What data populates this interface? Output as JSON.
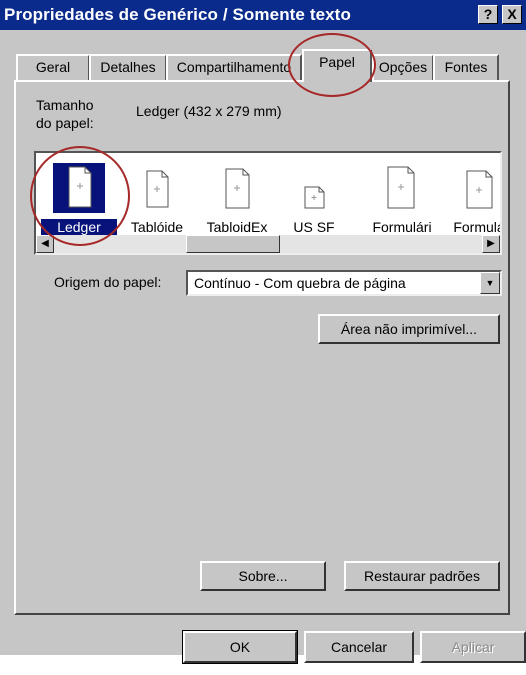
{
  "title": "Propriedades de Genérico / Somente texto",
  "title_buttons": {
    "help": "?",
    "close": "X"
  },
  "tabs": [
    {
      "label": "Geral"
    },
    {
      "label": "Detalhes"
    },
    {
      "label": "Compartilhamento"
    },
    {
      "label": "Papel",
      "active": true
    },
    {
      "label": "Opções"
    },
    {
      "label": "Fontes"
    }
  ],
  "paper_size": {
    "label_line1": "Tamanho",
    "label_line2": "do papel:",
    "value": "Ledger (432 x 279 mm)"
  },
  "papers": [
    {
      "name": "Ledger",
      "selected": true
    },
    {
      "name": "Tablóide"
    },
    {
      "name": "TabloidEx"
    },
    {
      "name": "US SF"
    },
    {
      "name": "Formulári"
    },
    {
      "name": "Formulá"
    }
  ],
  "paper_source": {
    "label": "Origem do papel:",
    "value": "Contínuo - Com quebra de página"
  },
  "buttons": {
    "unprintable_area": "Área não imprimível...",
    "about": "Sobre...",
    "restore_defaults": "Restaurar padrões",
    "ok": "OK",
    "cancel": "Cancelar",
    "apply": "Aplicar"
  },
  "colors": {
    "titlebar": "#0a2a8c",
    "selection": "#07137a",
    "face": "#c6c6c6",
    "annotation": "#a62828"
  },
  "icons": {
    "paper": "paper-sheet-icon",
    "scroll_left": "arrow-left-icon",
    "scroll_right": "arrow-right-icon",
    "dropdown": "chevron-down-icon"
  }
}
